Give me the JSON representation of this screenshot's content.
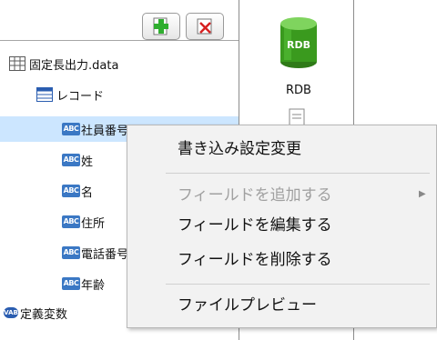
{
  "tree": {
    "root_label": "固定長出力.data",
    "record_label": "レコード",
    "fields": [
      {
        "label": "社員番号"
      },
      {
        "label": "姓"
      },
      {
        "label": "名"
      },
      {
        "label": "住所"
      },
      {
        "label": "電話番号"
      },
      {
        "label": "年齢"
      }
    ],
    "variables_label": "定義変数",
    "field_icon_text": "ABC",
    "var_icon_text": "VAB"
  },
  "rdb": {
    "icon_text": "RDB",
    "label": "RDB"
  },
  "context_menu": {
    "items": [
      {
        "label": "書き込み設定変更",
        "enabled": true
      },
      {
        "label": "フィールドを追加する",
        "enabled": false,
        "has_submenu": true
      },
      {
        "label": "フィールドを編集する",
        "enabled": true
      },
      {
        "label": "フィールドを削除する",
        "enabled": true
      },
      {
        "label": "ファイルプレビュー",
        "enabled": true
      }
    ]
  },
  "colors": {
    "selection": "#cce6ff",
    "field_icon": "#3b78c4",
    "rdb_icon": "#3a9a1e",
    "menu_bg": "#f2f2f2",
    "disabled_text": "#a0a0a0"
  }
}
